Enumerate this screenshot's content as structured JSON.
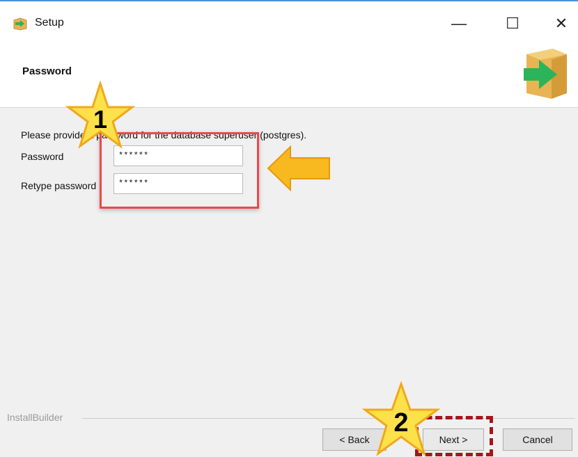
{
  "window": {
    "title": "Setup",
    "minimize": "—",
    "maximize": "☐",
    "close": "✕"
  },
  "header": {
    "title": "Password"
  },
  "form": {
    "instruction": "Please provide a password for the database superuser (postgres).",
    "password_label": "Password",
    "password_value": "******",
    "retype_label": "Retype password",
    "retype_value": "******"
  },
  "annotations": {
    "step1": "1",
    "step2": "2"
  },
  "footer": {
    "builder": "InstallBuilder",
    "back": "< Back",
    "next": "Next >",
    "cancel": "Cancel"
  },
  "colors": {
    "star_fill": "#fde14a",
    "star_stroke": "#f1a81b",
    "arrow_fill": "#f8b81f",
    "highlight_red": "#f0464a",
    "dashed_red": "#a8141c",
    "logo_box": "#e8b454",
    "logo_arrow": "#2db35a"
  }
}
